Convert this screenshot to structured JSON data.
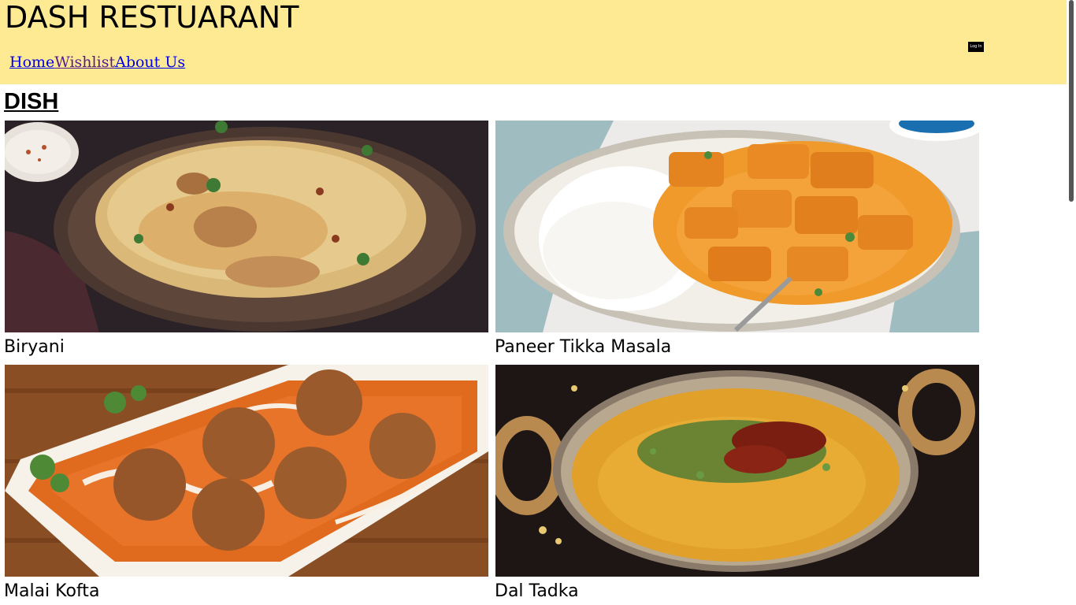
{
  "header": {
    "site_title": "DASH RESTUARANT",
    "nav": {
      "home": "Home",
      "wishlist": "Wishlist",
      "about": "About Us"
    },
    "login_label": "Log In",
    "background_color": "#ffea94"
  },
  "main": {
    "section_heading": "DISH",
    "dishes": [
      {
        "name": "Biryani",
        "image": "biryani-photo"
      },
      {
        "name": "Paneer Tikka Masala",
        "image": "paneer-tikka-masala-photo"
      },
      {
        "name": "Malai Kofta",
        "image": "malai-kofta-photo"
      },
      {
        "name": "Dal Tadka",
        "image": "dal-tadka-photo"
      }
    ]
  },
  "colors": {
    "link": "#0000ee",
    "visited_link": "#551a8b",
    "header_bg": "#ffea94",
    "login_bg": "#000000"
  }
}
